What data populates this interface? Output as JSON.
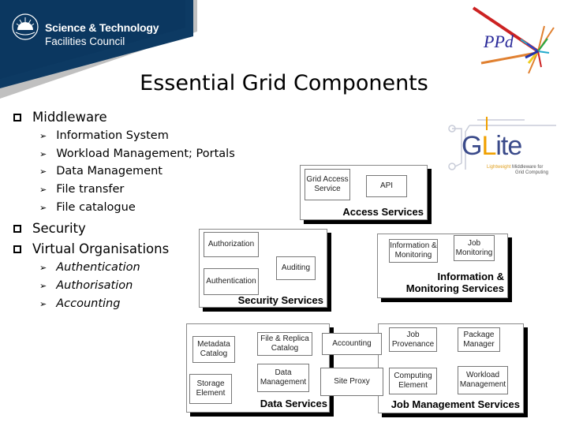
{
  "header": {
    "org_line1": "Science & Technology",
    "org_line2": "Facilities Council",
    "dept_logo": "PPd"
  },
  "slide": {
    "title": "Essential Grid Components"
  },
  "bullets": [
    {
      "label": "Middleware",
      "children": [
        "Information System",
        "Workload Management; Portals",
        "Data Management",
        "File transfer",
        "File catalogue"
      ]
    },
    {
      "label": "Security",
      "children": []
    },
    {
      "label": "Virtual Organisations",
      "children": [
        "Authentication",
        "Authorisation",
        "Accounting"
      ]
    }
  ],
  "glite_logo": {
    "wordmark_g": "G",
    "wordmark_l": "L",
    "wordmark_rest": "ite",
    "tagline_a": "Lightweight",
    "tagline_b": "Middleware for",
    "tagline_c": "Grid Computing"
  },
  "diagram": {
    "access": {
      "title": "Access Services",
      "components": [
        "Grid Access Service",
        "API"
      ]
    },
    "security": {
      "title": "Security Services",
      "components": [
        "Authorization",
        "Authentication",
        "Auditing"
      ]
    },
    "info": {
      "title_line1": "Information &",
      "title_line2": "Monitoring Services",
      "components": [
        "Information & Monitoring",
        "Job Monitoring"
      ]
    },
    "data": {
      "title": "Data Services",
      "components": [
        "Metadata Catalog",
        "File & Replica Catalog",
        "Storage Element",
        "Data Management"
      ]
    },
    "shared": [
      "Accounting",
      "Site Proxy"
    ],
    "job": {
      "title": "Job Management Services",
      "components": [
        "Job Provenance",
        "Package Manager",
        "Computing Element",
        "Workload Management"
      ]
    }
  }
}
